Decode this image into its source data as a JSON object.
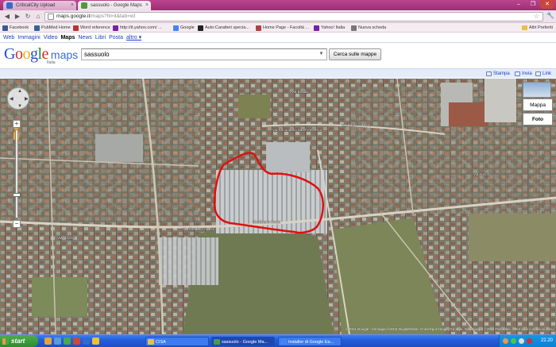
{
  "browser": {
    "tabs": [
      {
        "label": "CriticalCity Upload",
        "active": false,
        "icon_color": "#2b6fc9"
      },
      {
        "label": "sassuolo - Google Maps",
        "active": true,
        "icon_color": "#4a9d3a"
      }
    ],
    "url_host": "maps.google.it",
    "url_rest": "/maps?hl=it&tab=wl",
    "bookmarks": [
      {
        "label": "Facebook",
        "icon_color": "#3b5998"
      },
      {
        "label": "PubMed Home",
        "icon_color": "#326599"
      },
      {
        "label": "Word reference",
        "icon_color": "#b33"
      },
      {
        "label": "http://it.yahoo.com/ ...",
        "icon_color": "#7b1fa2"
      },
      {
        "label": "Google",
        "icon_color": "#4285f4"
      },
      {
        "label": "Auto:Caratteri specia...",
        "icon_color": "#222"
      },
      {
        "label": "Home Page - Facoltà ...",
        "icon_color": "#a44"
      },
      {
        "label": "Yahoo! Italia",
        "icon_color": "#7b1fa2"
      },
      {
        "label": "Nuova scheda",
        "icon_color": "#777"
      }
    ],
    "other_bookmarks": "Altri Preferiti"
  },
  "google_nav": {
    "items": [
      "Web",
      "Immagini",
      "Video",
      "Maps",
      "News",
      "Libri",
      "Posta"
    ],
    "active": "Maps",
    "more": "altro ▾"
  },
  "logo": {
    "maps": "maps",
    "sub": "Italia"
  },
  "search": {
    "value": "sassuolo",
    "button": "Cerca sulle mappe"
  },
  "linkbar": {
    "print": "Stampa",
    "send": "Invia",
    "link": "Link"
  },
  "map": {
    "type_buttons": [
      "Mappa",
      "Foto"
    ],
    "active_type": "Foto",
    "copyright": "©2011 Google - Immagini ©2011 DigitalGlobe, Cnes/Spot Image, GeoEye, Dati mappa ©2011 Tele Atlas - Termini e condizioni d'uso",
    "street_labels": [
      {
        "text": "Via Circondario San Francesco"
      },
      {
        "text": "Via Statale Ovest"
      },
      {
        "text": "Via Mazzini"
      },
      {
        "text": "Via Ancora"
      },
      {
        "text": "Via Braida"
      },
      {
        "text": "Via Radici in Piano"
      },
      {
        "text": "Via Stradone Ovest"
      }
    ]
  },
  "taskbar": {
    "start": "start",
    "tasks": [
      {
        "label": "CISA",
        "active": false,
        "icon_color": "#e8c04a"
      },
      {
        "label": "sassuolo - Google Ma...",
        "active": true,
        "icon_color": "#4a9d3a"
      },
      {
        "label": "Installer di Google Ea...",
        "active": false,
        "icon_color": "#4285f4"
      }
    ],
    "clock": "22.20"
  }
}
